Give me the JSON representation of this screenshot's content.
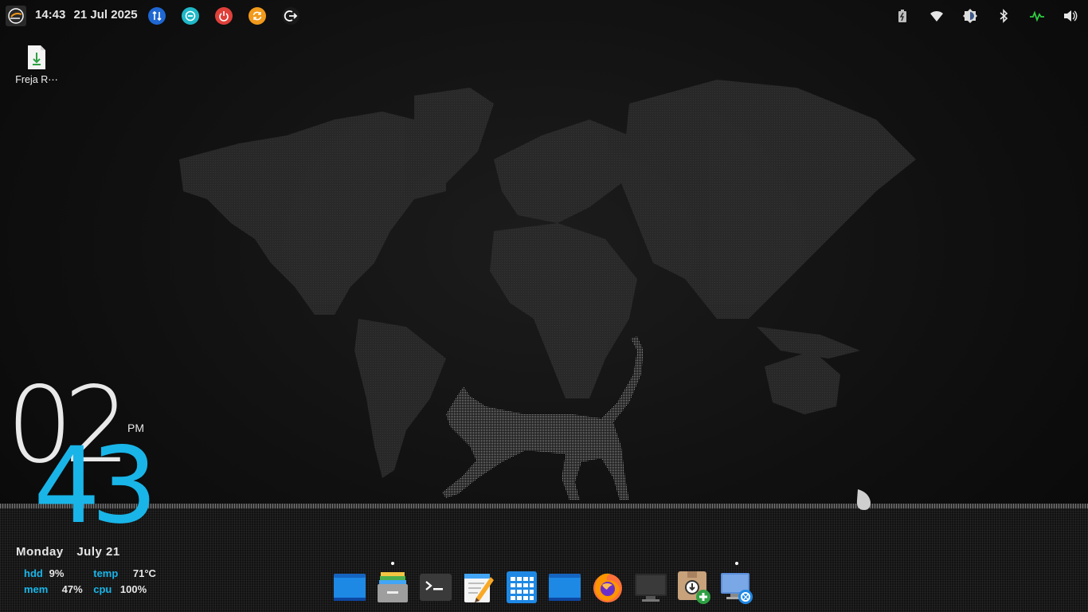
{
  "top_panel": {
    "time": "14:43",
    "date": "21 Jul 2025",
    "launcher_icon": "endeavour-logo-icon",
    "buttons": [
      {
        "name": "network-transfer-icon",
        "color": "#1f67d2"
      },
      {
        "name": "do-not-disturb-icon",
        "color": "#1fb8c8"
      },
      {
        "name": "power-icon",
        "color": "#e0403a"
      },
      {
        "name": "update-icon",
        "color": "#f29a1b"
      },
      {
        "name": "logout-icon",
        "color": "#ffffff"
      }
    ],
    "tray": [
      "battery-icon",
      "wifi-icon",
      "brightness-icon",
      "bluetooth-icon",
      "system-monitor-icon",
      "volume-icon"
    ]
  },
  "desktop_file": {
    "label": "Freja R⋯",
    "icon": "download-file-icon"
  },
  "clock_widget": {
    "hours": "02",
    "minutes": "43",
    "ampm": "PM",
    "day": "Monday",
    "date": "July 21",
    "stats": {
      "hdd_label": "hdd",
      "hdd_value": "9%",
      "temp_label": "temp",
      "temp_value": "71°C",
      "mem_label": "mem",
      "mem_value": "47%",
      "cpu_label": "cpu",
      "cpu_value": "100%"
    },
    "accent": "#19b5e8"
  },
  "dock": [
    {
      "name": "dock-blue-window-icon",
      "running": false
    },
    {
      "name": "dock-file-manager-icon",
      "running": true
    },
    {
      "name": "dock-terminal-icon",
      "running": false
    },
    {
      "name": "dock-text-editor-icon",
      "running": false
    },
    {
      "name": "dock-calculator-icon",
      "running": false
    },
    {
      "name": "dock-blue-window-2-icon",
      "running": false
    },
    {
      "name": "dock-firefox-icon",
      "running": false
    },
    {
      "name": "dock-display-icon",
      "running": false
    },
    {
      "name": "dock-package-installer-icon",
      "running": false
    },
    {
      "name": "dock-screenshot-icon",
      "running": true
    }
  ]
}
